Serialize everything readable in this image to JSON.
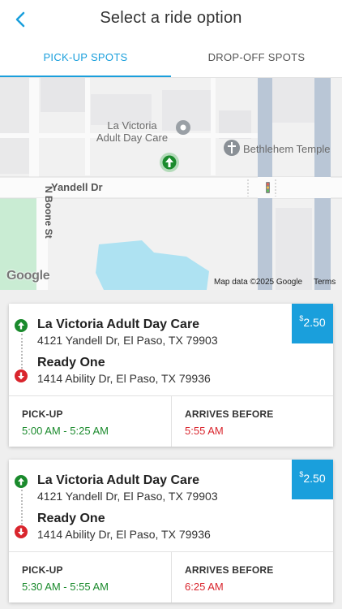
{
  "header": {
    "title": "Select a ride option",
    "back_icon": "chevron-left-icon"
  },
  "tabs": [
    {
      "label": "PICK-UP SPOTS",
      "active": true
    },
    {
      "label": "DROP-OFF SPOTS",
      "active": false
    }
  ],
  "map": {
    "poi_main": "La Victoria\nAdult Day Care",
    "poi_church": "Bethlehem Temple",
    "street_main": "Yandell Dr",
    "street_side": "N Boone St",
    "logo": "Google",
    "attribution": "Map data ©2025 Google",
    "terms": "Terms"
  },
  "rides": [
    {
      "price_symbol": "$",
      "price": "2.50",
      "pickup_name": "La Victoria Adult Day Care",
      "pickup_address": "4121 Yandell Dr, El Paso, TX 79903",
      "dropoff_name": "Ready One",
      "dropoff_address": "1414 Ability Dr, El Paso, TX 79936",
      "pickup_label": "PICK-UP",
      "pickup_window": "5:00 AM - 5:25 AM",
      "arrives_label": "ARRIVES BEFORE",
      "arrives_time": "5:55 AM"
    },
    {
      "price_symbol": "$",
      "price": "2.50",
      "pickup_name": "La Victoria Adult Day Care",
      "pickup_address": "4121 Yandell Dr, El Paso, TX 79903",
      "dropoff_name": "Ready One",
      "dropoff_address": "1414 Ability Dr, El Paso, TX 79936",
      "pickup_label": "PICK-UP",
      "pickup_window": "5:30 AM - 5:55 AM",
      "arrives_label": "ARRIVES BEFORE",
      "arrives_time": "6:25 AM"
    }
  ],
  "colors": {
    "accent": "#1a9fdc",
    "green": "#1a8a2c",
    "red": "#d9252d"
  }
}
